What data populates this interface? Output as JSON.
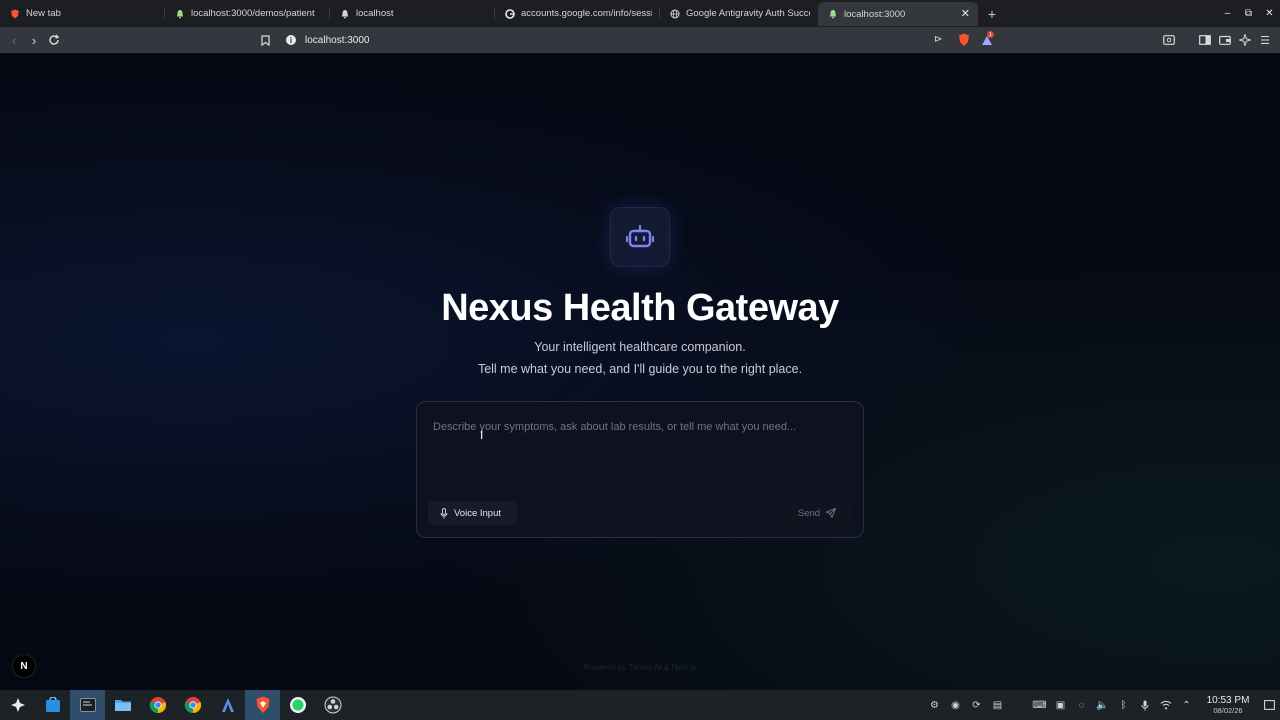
{
  "browser": {
    "tabs": [
      {
        "title": "New tab",
        "favicon": "brave-icon"
      },
      {
        "title": "localhost:3000/demos/patient",
        "favicon": "bell-icon"
      },
      {
        "title": "localhost",
        "favicon": "bell-icon"
      },
      {
        "title": "accounts.google.com/info/sessi",
        "favicon": "google-icon"
      },
      {
        "title": "Google Antigravity Auth Success",
        "favicon": "globe-icon"
      },
      {
        "title": "localhost:3000",
        "favicon": "bell-icon",
        "active": true
      }
    ],
    "new_tab": "+",
    "address": "localhost:3000",
    "notification_count": "1"
  },
  "page": {
    "title": "Nexus Health Gateway",
    "subtitle_line1": "Your intelligent healthcare companion.",
    "subtitle_line2": "Tell me what you need, and I'll guide you to the right place.",
    "prompt_placeholder": "Describe your symptoms, ask about lab results, or tell me what you need...",
    "prompt_value": "",
    "voice_label": "Voice Input",
    "send_label": "Send",
    "footer": "Powered by Tambo AI & Next.js",
    "next_badge": "N",
    "accent_color": "#7b83f2"
  },
  "taskbar": {
    "time": "10:53 PM",
    "date": "08/02/26"
  }
}
